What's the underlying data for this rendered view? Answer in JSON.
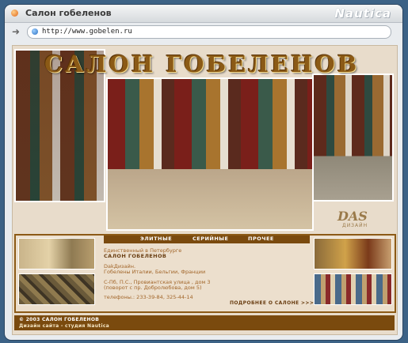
{
  "browser": {
    "window_title": "Салон гобеленов",
    "brand": "Nautica",
    "url": "http://www.gobelen.ru"
  },
  "site": {
    "logo_title": "САЛОН ГОБЕЛЕНОВ",
    "design_logo_mark": "DAS",
    "design_logo_sub": "ДИЗАЙН",
    "menu": [
      "ЭЛИТНЫЕ",
      "СЕРИЙНЫЕ",
      "ПРОЧЕЕ"
    ],
    "info": {
      "line1": "Единственный в Петербурге",
      "line2": "САЛОН ГОБЕЛЕНОВ",
      "line3": "DakДизайн.",
      "line4": "Гобелены Италии, Бельгии, Франции",
      "line5": "С-Пб, П.С., Провиантская улица , дом 3",
      "line6": "(поворот с пр. Добролюбова, дом 5)",
      "line7": "телефоны.: 233-39-84, 325-44-14"
    },
    "more_link": "ПОДРОБНЕЕ О САЛОНЕ >>>",
    "footer": {
      "copyright": "© 2003 САЛОН ГОБЕЛЕНОВ",
      "credit": "Дизайн сайта - студия Nautica"
    }
  },
  "colors": {
    "page_bg": "#e8dccb",
    "accent_brown": "#7a4a0e",
    "text_orange": "#a2662a",
    "desktop_blue": "#3c6286"
  }
}
